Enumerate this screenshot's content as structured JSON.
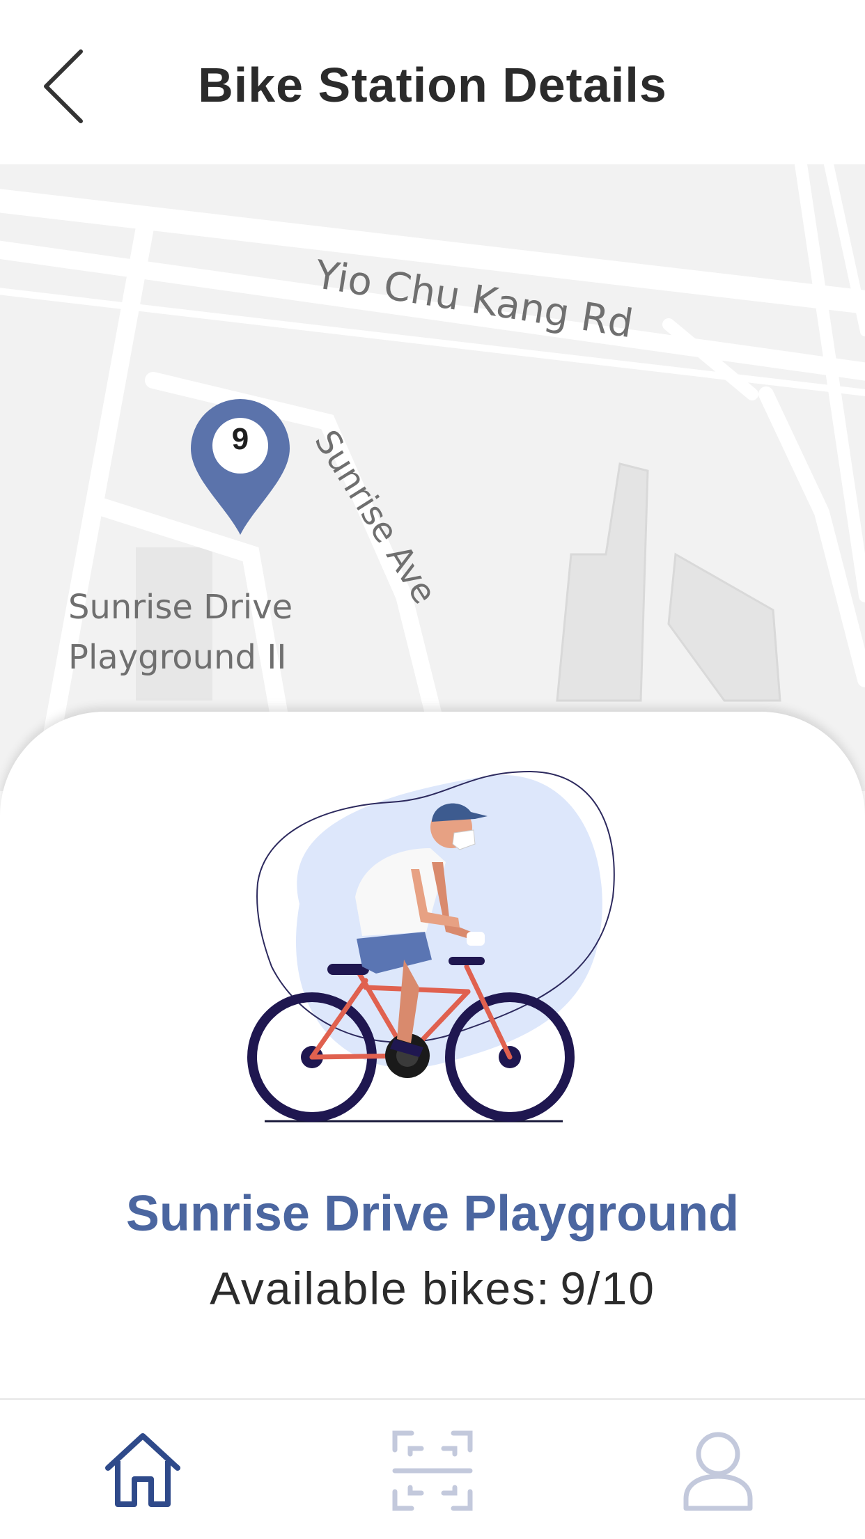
{
  "header": {
    "title": "Bike Station Details",
    "back_icon": "chevron-left-icon"
  },
  "map": {
    "roads": [
      "Yio Chu Kang Rd",
      "Sunrise Ave"
    ],
    "place_label": [
      "Sunrise Drive",
      "Playground II"
    ],
    "pin": {
      "count": "9",
      "color": "#5b73ab"
    }
  },
  "station": {
    "name": "Sunrise Drive Playground",
    "available_label": "Available bikes:",
    "available_value": "9/10",
    "available": 9,
    "capacity": 10
  },
  "nav": {
    "items": [
      {
        "icon": "home-icon",
        "active": true
      },
      {
        "icon": "scan-icon",
        "active": false
      },
      {
        "icon": "user-icon",
        "active": false
      }
    ]
  },
  "colors": {
    "accent": "#4b66a0",
    "nav_active": "#2f4a8a",
    "nav_inactive": "#c3c9dc",
    "map_bg": "#f2f2f2"
  }
}
